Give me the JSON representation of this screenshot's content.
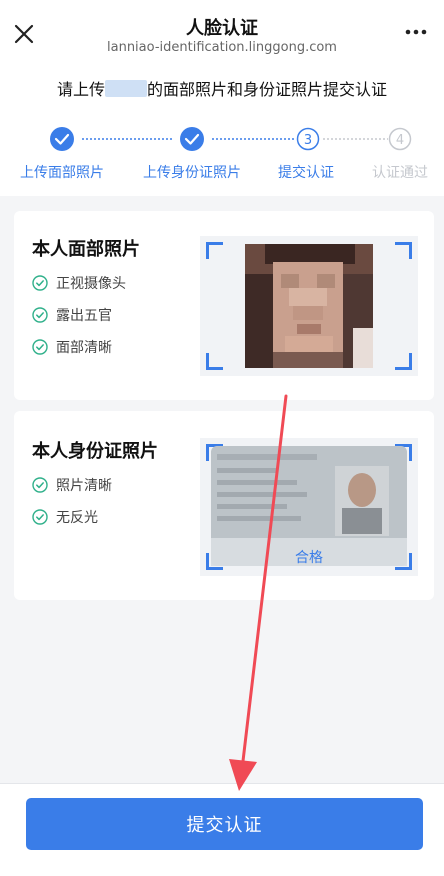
{
  "header": {
    "title": "人脸认证",
    "url": "lanniao-identification.linggong.com"
  },
  "instruction": {
    "prefix": "请上传",
    "suffix": "的面部照片和身份证照片提交认证"
  },
  "steps": [
    {
      "label": "上传面部照片",
      "status": "done",
      "mark": "check"
    },
    {
      "label": "上传身份证照片",
      "status": "done",
      "mark": "check"
    },
    {
      "label": "提交认证",
      "status": "current",
      "mark": "3"
    },
    {
      "label": "认证通过",
      "status": "pending",
      "mark": "4"
    }
  ],
  "face_card": {
    "title": "本人面部照片",
    "requirements": [
      "正视摄像头",
      "露出五官",
      "面部清晰"
    ]
  },
  "id_card": {
    "title": "本人身份证照片",
    "requirements": [
      "照片清晰",
      "无反光"
    ],
    "pass_label": "合格"
  },
  "submit": {
    "label": "提交认证"
  },
  "colors": {
    "accent": "#3a7de8",
    "success": "#2fb08a",
    "annotation": "#f04a55"
  }
}
